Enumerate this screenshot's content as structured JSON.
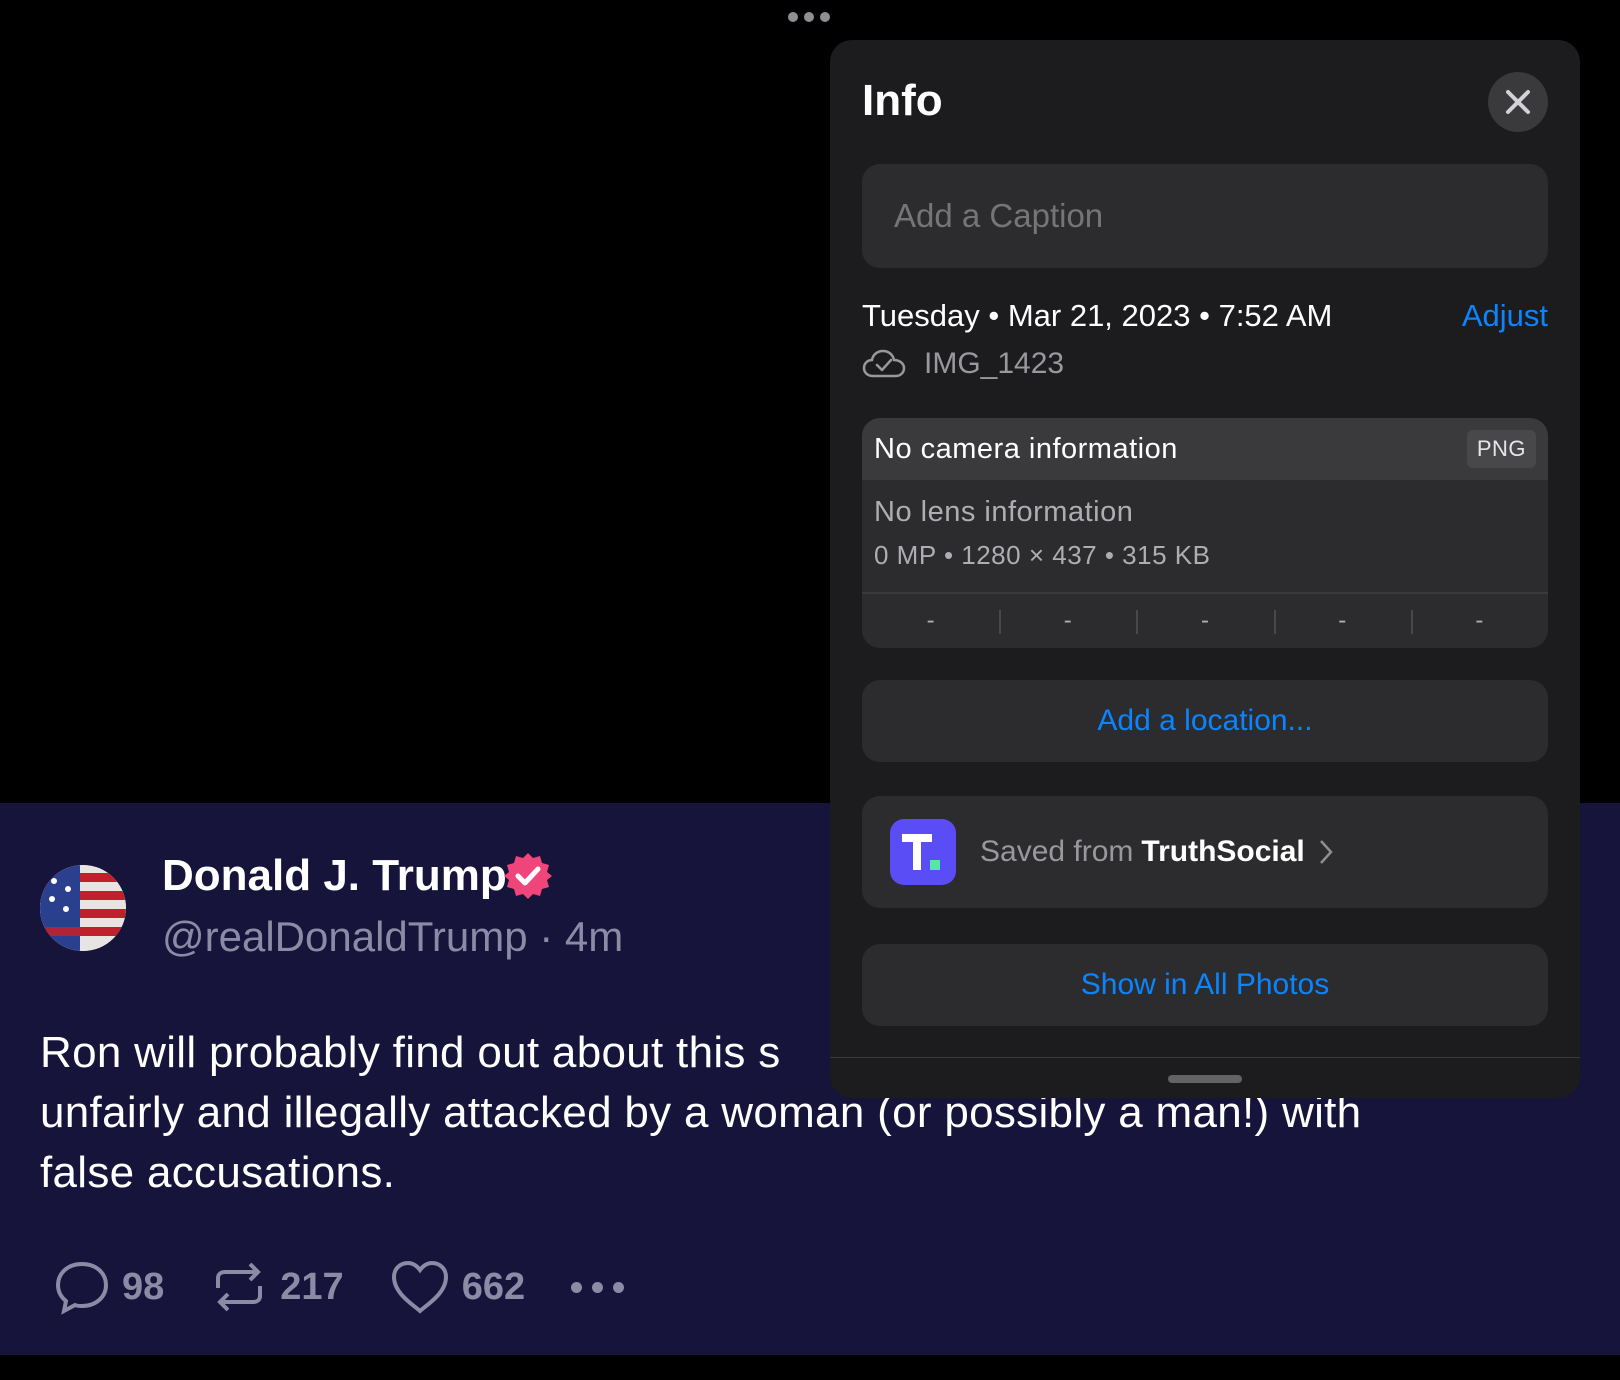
{
  "post": {
    "author_name": "Donald J. Trump",
    "handle_time": "@realDonaldTrump · 4m",
    "text": "Ron will probably find out about this s... unfairly and illegally attacked by a woman (or possibly a man!) with false accusations.",
    "text_line1": "Ron will probably find out about this s",
    "text_line2": "unfairly and illegally attacked by a woman (or possibly a man!) with",
    "text_line3": "false accusations.",
    "replies": "98",
    "retruths": "217",
    "likes": "662",
    "verified_color": "#f0457a"
  },
  "info": {
    "title": "Info",
    "caption_placeholder": "Add a Caption",
    "date": "Tuesday • Mar 21, 2023 • 7:52 AM",
    "adjust_label": "Adjust",
    "filename": "IMG_1423",
    "camera": "No camera information",
    "format": "PNG",
    "lens": "No lens information",
    "specs": "0 MP  •  1280 × 437  •  315 KB",
    "exif": [
      "-",
      "-",
      "-",
      "-",
      "-"
    ],
    "location_label": "Add a location...",
    "saved_prefix": "Saved from",
    "saved_app": "TruthSocial",
    "show_all_label": "Show in All Photos",
    "accent_color": "#0a84ff"
  }
}
